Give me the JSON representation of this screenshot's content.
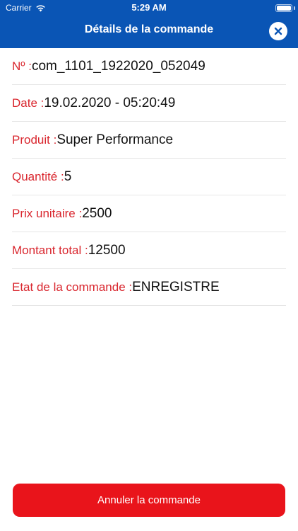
{
  "status_bar": {
    "carrier": "Carrier",
    "time": "5:29 AM",
    "battery_level": 1.0
  },
  "header": {
    "title": "Détails de la commande",
    "close_icon": "close-icon",
    "background_color": "#0a55b5"
  },
  "order": {
    "rows": [
      {
        "label": "Nº :",
        "value": "com_1101_1922020_052049"
      },
      {
        "label": "Date :",
        "value": "19.02.2020 - 05:20:49"
      },
      {
        "label": "Produit :",
        "value": "Super Performance"
      },
      {
        "label": "Quantité :",
        "value": "5"
      },
      {
        "label": "Prix unitaire :",
        "value": "2500"
      },
      {
        "label": "Montant total :",
        "value": "12500"
      },
      {
        "label": "Etat de la commande :",
        "value": "ENREGISTRE"
      }
    ]
  },
  "footer": {
    "cancel_label": "Annuler la commande",
    "button_color": "#e9141b"
  },
  "colors": {
    "label": "#d9262e",
    "value": "#111111"
  }
}
